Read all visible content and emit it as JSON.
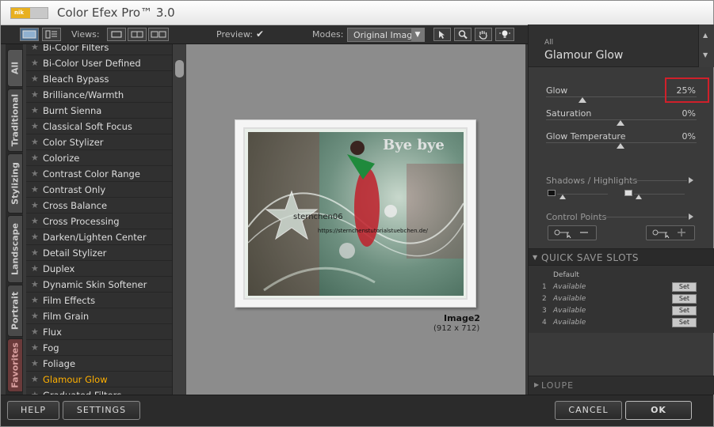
{
  "window": {
    "title": "Color Efex Pro™ 3.0",
    "logo_text": "nik"
  },
  "toolbar": {
    "views_label": "Views:",
    "preview_label": "Preview:",
    "preview_checked": "✔",
    "modes_label": "Modes:",
    "mode_value": "Original Image"
  },
  "tabs": [
    "All",
    "Traditional",
    "Stylizing",
    "Landscape",
    "Portrait",
    "Favorites"
  ],
  "filters": [
    "Bi-Color Filters",
    "Bi-Color User Defined",
    "Bleach Bypass",
    "Brilliance/Warmth",
    "Burnt Sienna",
    "Classical Soft Focus",
    "Color Stylizer",
    "Colorize",
    "Contrast Color Range",
    "Contrast Only",
    "Cross Balance",
    "Cross Processing",
    "Darken/Lighten Center",
    "Detail Stylizer",
    "Duplex",
    "Dynamic Skin Softener",
    "Film Effects",
    "Film Grain",
    "Flux",
    "Fog",
    "Foliage",
    "Glamour Glow",
    "Graduated Filters"
  ],
  "selected_filter_index": 21,
  "preview": {
    "image_name": "Image2",
    "image_size": "(912 x 712)",
    "watermark_top": "Bye bye",
    "watermark_mid": "sternchen06",
    "watermark_url": "https://sternchenstutorialstuebchen.de/"
  },
  "panel": {
    "category": "All",
    "filter_name": "Glamour Glow",
    "sliders": [
      {
        "label": "Glow",
        "value": "25%"
      },
      {
        "label": "Saturation",
        "value": "0%"
      },
      {
        "label": "Glow Temperature",
        "value": "0%"
      }
    ],
    "shadows_highlights": "Shadows / Highlights",
    "control_points": "Control Points",
    "quick_save_title": "QUICK SAVE SLOTS",
    "slots_default": "Default",
    "slots": [
      {
        "num": "1",
        "status": "Available",
        "btn": "Set"
      },
      {
        "num": "2",
        "status": "Available",
        "btn": "Set"
      },
      {
        "num": "3",
        "status": "Available",
        "btn": "Set"
      },
      {
        "num": "4",
        "status": "Available",
        "btn": "Set"
      }
    ],
    "loupe": "LOUPE"
  },
  "buttons": {
    "help": "HELP",
    "settings": "SETTINGS",
    "cancel": "CANCEL",
    "ok": "OK"
  },
  "colors": {
    "selected_filter": "#ffb000",
    "highlight_box": "#d0202a",
    "background": "#3a3a3a"
  }
}
